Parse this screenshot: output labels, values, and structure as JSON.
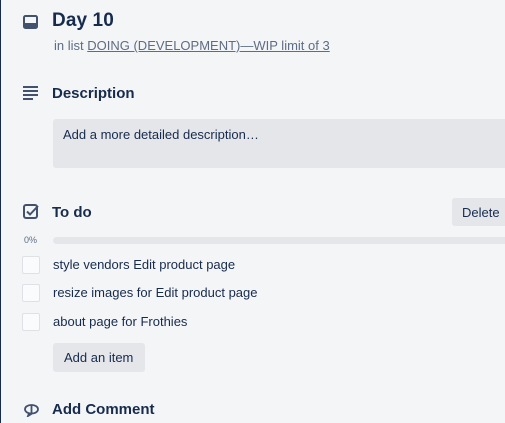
{
  "card": {
    "title": "Day 10",
    "list_prefix": "in list",
    "list_name": "DOING (DEVELOPMENT)—WIP limit of 3"
  },
  "description": {
    "heading": "Description",
    "placeholder": "Add a more detailed description…"
  },
  "checklist": {
    "heading": "To do",
    "delete_label": "Delete",
    "progress_label": "0%",
    "progress_fraction": 0,
    "items": [
      {
        "text": "style vendors Edit product page",
        "checked": false
      },
      {
        "text": "resize images for Edit product page",
        "checked": false
      },
      {
        "text": "about page for Frothies",
        "checked": false
      }
    ],
    "add_item_label": "Add an item"
  },
  "comment": {
    "heading": "Add Comment"
  },
  "icons": {
    "card": "card-icon",
    "description": "description-lines-icon",
    "checklist": "checkbox-checked-icon",
    "comment": "speech-bubble-icon"
  },
  "colors": {
    "text": "#172b4d",
    "muted": "#5e6c84",
    "button_bg": "#e4e6ea",
    "page_bg": "#f4f5f7",
    "progress_fill": "#61bd4f"
  }
}
